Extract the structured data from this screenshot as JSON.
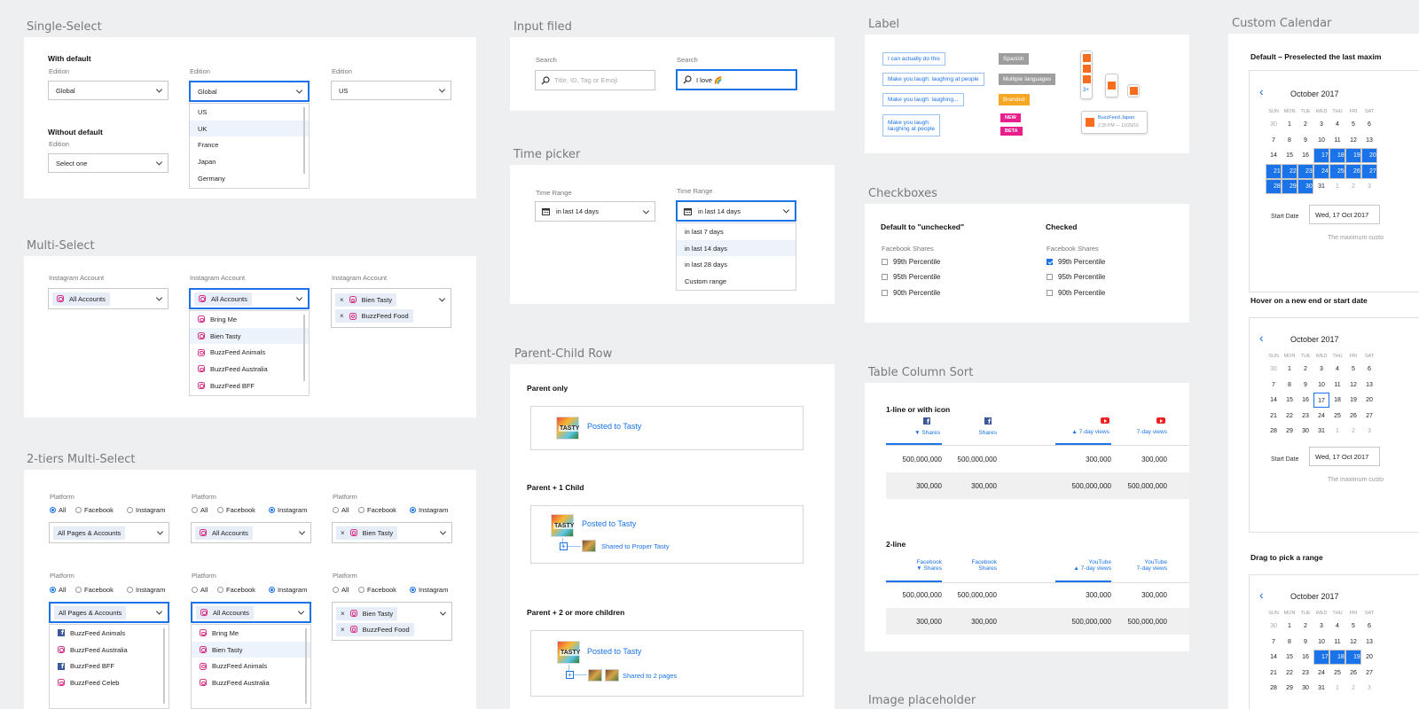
{
  "single_select": {
    "title": "Single-Select",
    "with_default": "With default",
    "without_default": "Without default",
    "edition_label": "Edition",
    "select1": "Global",
    "select2": "Global",
    "select3": "US",
    "select4": "Select one",
    "options": [
      "US",
      "UK",
      "France",
      "Japan",
      "Germany"
    ]
  },
  "multi_select": {
    "title": "Multi-Select",
    "account_label": "Instagram Account",
    "chip_all": "All Accounts",
    "chip_bien": "Bien Tasty",
    "chip_bf_food": "BuzzFeed Food",
    "options": [
      "Bring Me",
      "Bien Tasty",
      "BuzzFeed Animals",
      "BuzzFeed Australia",
      "BuzzFeed BFF"
    ]
  },
  "two_tier": {
    "title": "2-tiers Multi-Select",
    "platform_label": "Platform",
    "radio_all": "All",
    "radio_fb": "Facebook",
    "radio_ig": "Instagram",
    "chip_pages": "All Pages & Accounts",
    "chip_all": "All Accounts",
    "chip_bien": "Bien Tasty",
    "chip_bf_food": "BuzzFeed Food",
    "mixed_options": [
      "BuzzFeed Animals",
      "BuzzFeed Australia",
      "BuzzFeed BFF",
      "BuzzFeed Celeb"
    ],
    "ig_options": [
      "Bring Me",
      "Bien Tasty",
      "BuzzFeed Animals",
      "BuzzFeed Australia"
    ]
  },
  "input_field": {
    "title": "Input filed",
    "search_label": "Search",
    "placeholder": "Title, ID, Tag or Emoji",
    "value": "I love 🌈"
  },
  "time_picker": {
    "title": "Time picker",
    "range_label": "Time Range",
    "value1": "in last 14 days",
    "value2": "in last 14 days",
    "options": [
      "in last 7 days",
      "in last 14 days",
      "in last 28 days",
      "Custom range"
    ]
  },
  "parent_child": {
    "title": "Parent-Child Row",
    "parent_only": "Parent only",
    "parent_one": "Parent + 1 Child",
    "parent_two": "Parent + 2 or more children",
    "posted": "Posted to Tasty",
    "shared_proper": "Shared to Proper Tasty",
    "shared_pages": "Shared to 2 pages"
  },
  "label": {
    "title": "Label",
    "text1": "I can actually do this",
    "text2": "Make you laugh: laughing at people",
    "text3": "Make you laugh: laughing...",
    "text4a": "Make you laugh:",
    "text4b": "laughing at people",
    "tag_spanish": "Spanish",
    "tag_multi": "Multiple languages",
    "tag_branded": "Branded",
    "tag_new": "NEW",
    "tag_beta": "BETA",
    "stack_count": "3+",
    "card_title": "BuzzFeed Japan",
    "card_time": "2:35 PM — 12/29/16",
    "colors": {
      "spanish": "#9e9e9e",
      "multi": "#9e9e9e",
      "branded": "#f5a623",
      "new": "#e91e8c",
      "beta": "#e91e8c"
    }
  },
  "checkboxes": {
    "title": "Checkboxes",
    "col1_title": "Default to \"unchecked\"",
    "col2_title": "Checked",
    "group_label": "Facebook Shares",
    "items": [
      "99th Percentile",
      "95th Percentile",
      "90th Percentile"
    ]
  },
  "table_sort": {
    "title": "Table Column Sort",
    "sub1": "1-line or with icon",
    "sub2": "2-line",
    "h_shares": "Shares",
    "h_views": "7-day views",
    "h_fb": "Facebook",
    "h_yt": "YouTube",
    "big": "500,000,000",
    "small": "300,000"
  },
  "calendar": {
    "title": "Custom Calendar",
    "sub1": "Default – Preselected the last maxim",
    "sub2": "Hover on a new end or start date",
    "sub3": "Drag to pick a range",
    "month": "October 2017",
    "weekdays": [
      "SUN",
      "MON",
      "TUE",
      "WED",
      "THU",
      "FRI",
      "SAT"
    ],
    "start_label": "Start Date",
    "start_value": "Wed, 17 Oct 2017",
    "note": "The maximum custo"
  },
  "image_placeholder": {
    "title": "Image placeholder"
  }
}
